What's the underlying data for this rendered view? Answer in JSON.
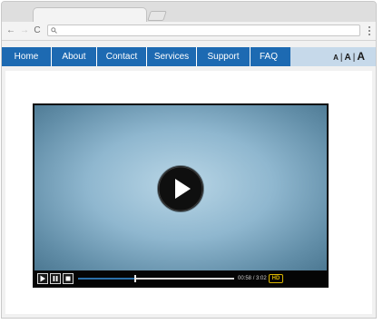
{
  "browser": {
    "back_glyph": "←",
    "forward_glyph": "→",
    "reload_glyph": "C",
    "search_glyph": "🔍",
    "address_value": ""
  },
  "navbar": {
    "items": [
      {
        "label": "Home"
      },
      {
        "label": "About"
      },
      {
        "label": "Contact"
      },
      {
        "label": "Services"
      },
      {
        "label": "Support"
      },
      {
        "label": "FAQ"
      }
    ],
    "font_size_controls": {
      "small": "A",
      "medium": "A",
      "large": "A",
      "separator": "|"
    },
    "colors": {
      "bar": "#1d6ab2",
      "bar_extension": "#c6d9ea"
    }
  },
  "player": {
    "time_current": "00:58",
    "time_total": "3:02",
    "time_separator": "/",
    "hd_label": "HD",
    "progress_fraction": 0.36,
    "colors": {
      "progress": "#2b6fa8",
      "hd": "#d9b400"
    }
  },
  "icons": {
    "back": "arrow-left-icon",
    "forward": "arrow-right-icon",
    "reload": "reload-icon",
    "search": "search-icon",
    "menu": "kebab-menu-icon",
    "big_play": "play-icon",
    "play": "play-icon",
    "pause": "pause-icon",
    "stop": "stop-icon"
  }
}
